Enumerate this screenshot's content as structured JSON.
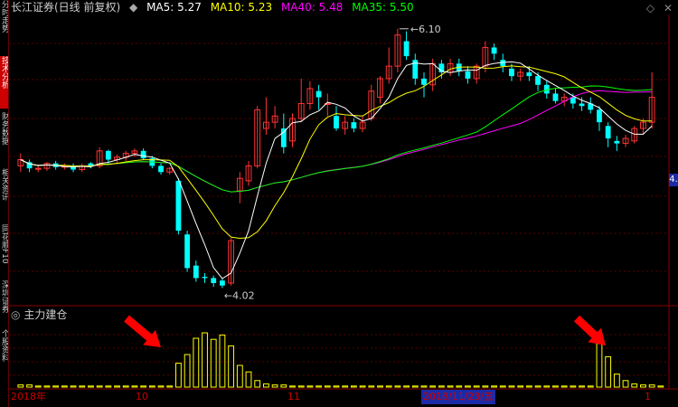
{
  "header": {
    "title": "长江证券(日线 前复权)",
    "indicators": [
      {
        "label": "MA5: 5.27",
        "color": "#ffffff"
      },
      {
        "label": "MA10: 5.23",
        "color": "#ffff00"
      },
      {
        "label": "MA40: 5.48",
        "color": "#ff00ff"
      },
      {
        "label": "MA35: 5.50",
        "color": "#00ff00"
      }
    ]
  },
  "sidebar": {
    "items": [
      {
        "label": "分时走势"
      },
      {
        "label": "技术分析",
        "active": true
      },
      {
        "label": "财务数据"
      },
      {
        "label": "相关资讯"
      },
      {
        "label": "同花顺F10"
      },
      {
        "label": "深圳证券"
      },
      {
        "label": "个股资料"
      }
    ]
  },
  "sub_panel": {
    "title": "主力建仓"
  },
  "annotations": {
    "high_label": "6.10",
    "low_label": "4.02",
    "price_tag": "4."
  },
  "date_axis": {
    "year_label": "2018年",
    "ticks": [
      "10",
      "11",
      "1"
    ],
    "selected_date": "2018/11/23/五"
  },
  "icons": {
    "options": "diamond-icon",
    "close": "close-icon"
  },
  "colors": {
    "up": "#ff3333",
    "down": "#00ffff",
    "ma5": "#ffffff",
    "ma10": "#ffff00",
    "ma40": "#ff00ff",
    "ma35": "#00ff00",
    "grid": "#5a0000",
    "vol": "#ffff00"
  },
  "chart_data": {
    "type": "candlestick",
    "y_range": [
      3.9,
      6.2
    ],
    "candles": [
      [
        5.0,
        5.05,
        5.1,
        4.95
      ],
      [
        5.03,
        4.98,
        5.05,
        4.95
      ],
      [
        4.98,
        4.98,
        5.0,
        4.95
      ],
      [
        4.98,
        5.02,
        5.03,
        4.96
      ],
      [
        5.02,
        4.99,
        5.04,
        4.97
      ],
      [
        4.99,
        5.0,
        5.02,
        4.97
      ],
      [
        5.0,
        4.97,
        5.02,
        4.95
      ],
      [
        4.97,
        5.0,
        5.02,
        4.95
      ],
      [
        5.02,
        5.0,
        5.03,
        4.98
      ],
      [
        5.0,
        5.12,
        5.15,
        4.98
      ],
      [
        5.12,
        5.05,
        5.13,
        5.02
      ],
      [
        5.05,
        5.07,
        5.09,
        5.02
      ],
      [
        5.07,
        5.1,
        5.12,
        5.04
      ],
      [
        5.1,
        5.12,
        5.14,
        5.07
      ],
      [
        5.12,
        5.06,
        5.14,
        5.05
      ],
      [
        5.06,
        5.0,
        5.08,
        4.98
      ],
      [
        5.0,
        4.95,
        5.02,
        4.93
      ],
      [
        4.95,
        4.98,
        4.99,
        4.93
      ],
      [
        4.88,
        4.48,
        4.9,
        4.45
      ],
      [
        4.45,
        4.18,
        4.48,
        4.15
      ],
      [
        4.2,
        4.1,
        4.24,
        4.07
      ],
      [
        4.11,
        4.1,
        4.14,
        4.06
      ],
      [
        4.1,
        4.06,
        4.12,
        4.03
      ],
      [
        4.08,
        4.04,
        4.1,
        4.02
      ],
      [
        4.06,
        4.4,
        4.42,
        4.04
      ],
      [
        4.8,
        4.9,
        4.95,
        4.7
      ],
      [
        4.88,
        5.0,
        5.04,
        4.84
      ],
      [
        5.0,
        5.45,
        5.48,
        4.98
      ],
      [
        5.3,
        5.35,
        5.55,
        5.25
      ],
      [
        5.35,
        5.4,
        5.48,
        5.3
      ],
      [
        5.3,
        5.15,
        5.42,
        5.1
      ],
      [
        5.2,
        5.38,
        5.42,
        5.15
      ],
      [
        5.38,
        5.5,
        5.7,
        5.35
      ],
      [
        5.5,
        5.62,
        5.68,
        5.45
      ],
      [
        5.6,
        5.55,
        5.65,
        5.45
      ],
      [
        5.5,
        5.5,
        5.58,
        5.4
      ],
      [
        5.4,
        5.3,
        5.48,
        5.28
      ],
      [
        5.3,
        5.35,
        5.4,
        5.25
      ],
      [
        5.35,
        5.3,
        5.38,
        5.27
      ],
      [
        5.3,
        5.35,
        5.4,
        5.27
      ],
      [
        5.38,
        5.6,
        5.65,
        5.36
      ],
      [
        5.55,
        5.7,
        5.72,
        5.5
      ],
      [
        5.7,
        5.8,
        5.95,
        5.66
      ],
      [
        5.8,
        6.05,
        6.1,
        5.75
      ],
      [
        6.0,
        5.88,
        6.08,
        5.85
      ],
      [
        5.85,
        5.7,
        5.9,
        5.65
      ],
      [
        5.7,
        5.65,
        5.75,
        5.55
      ],
      [
        5.65,
        5.82,
        5.86,
        5.6
      ],
      [
        5.82,
        5.75,
        5.85,
        5.7
      ],
      [
        5.75,
        5.82,
        5.86,
        5.72
      ],
      [
        5.82,
        5.76,
        5.86,
        5.72
      ],
      [
        5.76,
        5.7,
        5.8,
        5.66
      ],
      [
        5.7,
        5.8,
        5.82,
        5.66
      ],
      [
        5.8,
        5.95,
        6.0,
        5.75
      ],
      [
        5.95,
        5.9,
        5.98,
        5.85
      ],
      [
        5.85,
        5.8,
        5.9,
        5.75
      ],
      [
        5.78,
        5.72,
        5.82,
        5.68
      ],
      [
        5.72,
        5.75,
        5.78,
        5.68
      ],
      [
        5.75,
        5.72,
        5.8,
        5.68
      ],
      [
        5.72,
        5.65,
        5.75,
        5.6
      ],
      [
        5.65,
        5.58,
        5.68,
        5.54
      ],
      [
        5.58,
        5.52,
        5.62,
        5.5
      ],
      [
        5.52,
        5.55,
        5.58,
        5.48
      ],
      [
        5.55,
        5.5,
        5.58,
        5.46
      ],
      [
        5.5,
        5.48,
        5.55,
        5.44
      ],
      [
        5.5,
        5.45,
        5.55,
        5.42
      ],
      [
        5.45,
        5.35,
        5.48,
        5.28
      ],
      [
        5.32,
        5.22,
        5.35,
        5.15
      ],
      [
        5.2,
        5.18,
        5.24,
        5.12
      ],
      [
        5.18,
        5.22,
        5.25,
        5.15
      ],
      [
        5.2,
        5.3,
        5.32,
        5.18
      ],
      [
        5.3,
        5.35,
        5.38,
        5.25
      ],
      [
        5.35,
        5.55,
        5.75,
        5.3
      ]
    ],
    "vol_bars": [
      2,
      2,
      1,
      1,
      1,
      1,
      1,
      1,
      1,
      1,
      1,
      1,
      1,
      1,
      1,
      1,
      1,
      1,
      22,
      30,
      45,
      50,
      44,
      48,
      38,
      20,
      14,
      6,
      3,
      2,
      2,
      1,
      1,
      1,
      1,
      1,
      1,
      1,
      1,
      1,
      1,
      1,
      1,
      1,
      1,
      1,
      1,
      1,
      1,
      1,
      1,
      1,
      1,
      1,
      1,
      1,
      1,
      1,
      1,
      1,
      1,
      1,
      1,
      1,
      1,
      1,
      40,
      28,
      12,
      6,
      3,
      2,
      2,
      1
    ],
    "vol_range": [
      0,
      60
    ]
  }
}
